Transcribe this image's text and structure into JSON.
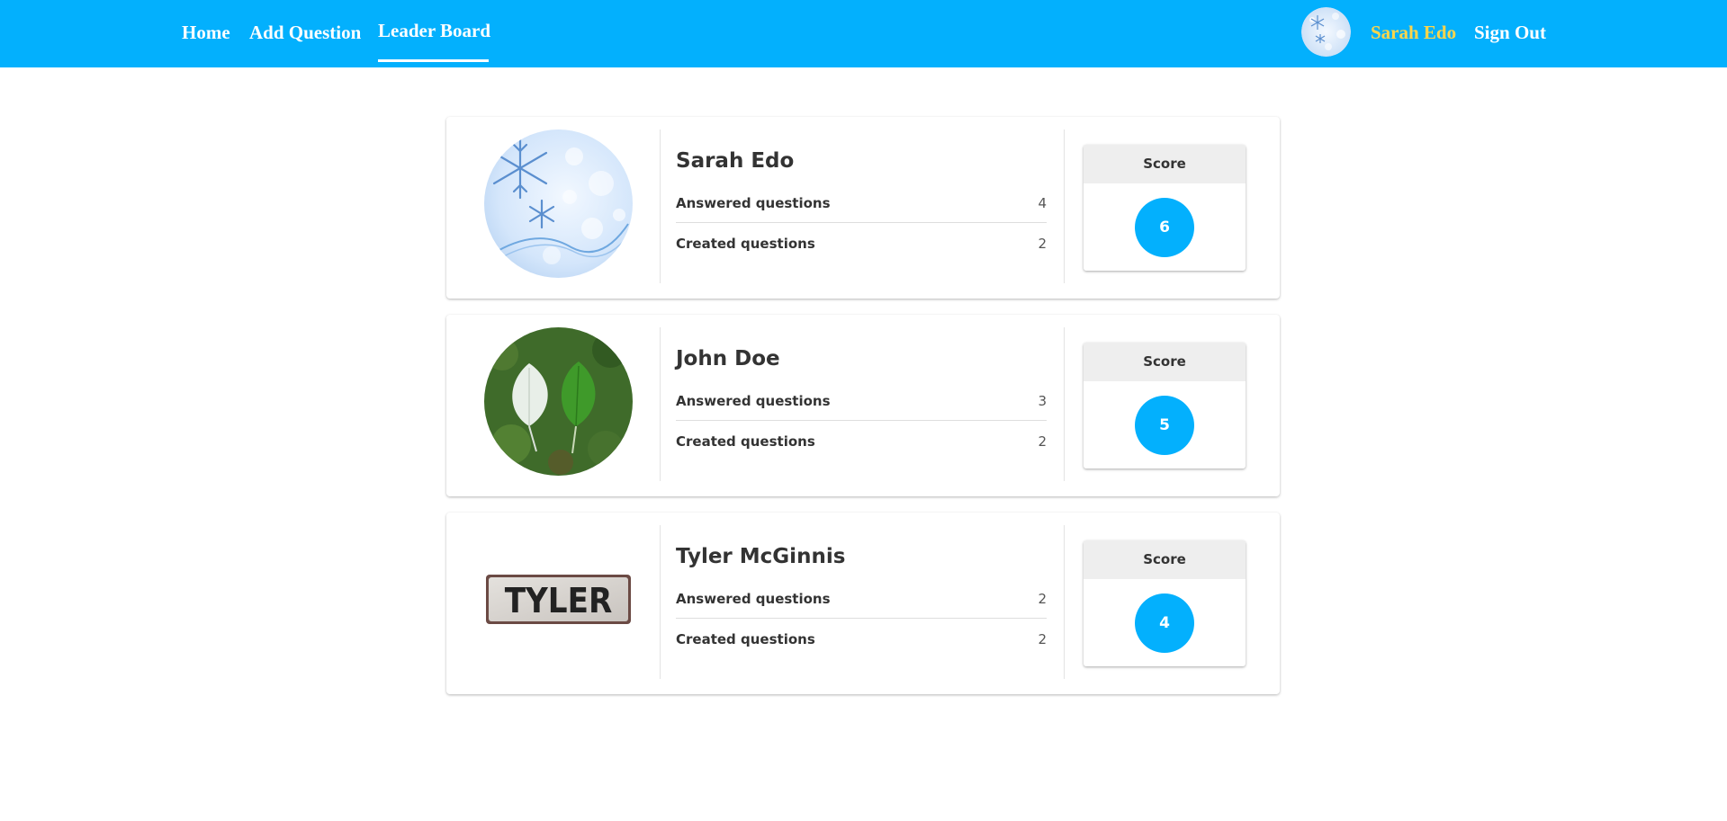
{
  "nav": {
    "home": "Home",
    "add_question": "Add Question",
    "leader_board": "Leader Board",
    "user_name": "Sarah Edo",
    "sign_out": "Sign Out"
  },
  "colors": {
    "primary": "#03b0fd",
    "user_name": "#ffd54a"
  },
  "leaderboard": [
    {
      "name": "Sarah Edo",
      "answered_label": "Answered questions",
      "answered": "4",
      "created_label": "Created questions",
      "created": "2",
      "score_label": "Score",
      "score": "6",
      "avatar": "snowflake-avatar"
    },
    {
      "name": "John Doe",
      "answered_label": "Answered questions",
      "answered": "3",
      "created_label": "Created questions",
      "created": "2",
      "score_label": "Score",
      "score": "5",
      "avatar": "leaves-avatar"
    },
    {
      "name": "Tyler McGinnis",
      "answered_label": "Answered questions",
      "answered": "2",
      "created_label": "Created questions",
      "created": "2",
      "score_label": "Score",
      "score": "4",
      "avatar": "tyler-sign-avatar",
      "avatar_text": "TYLER"
    }
  ]
}
